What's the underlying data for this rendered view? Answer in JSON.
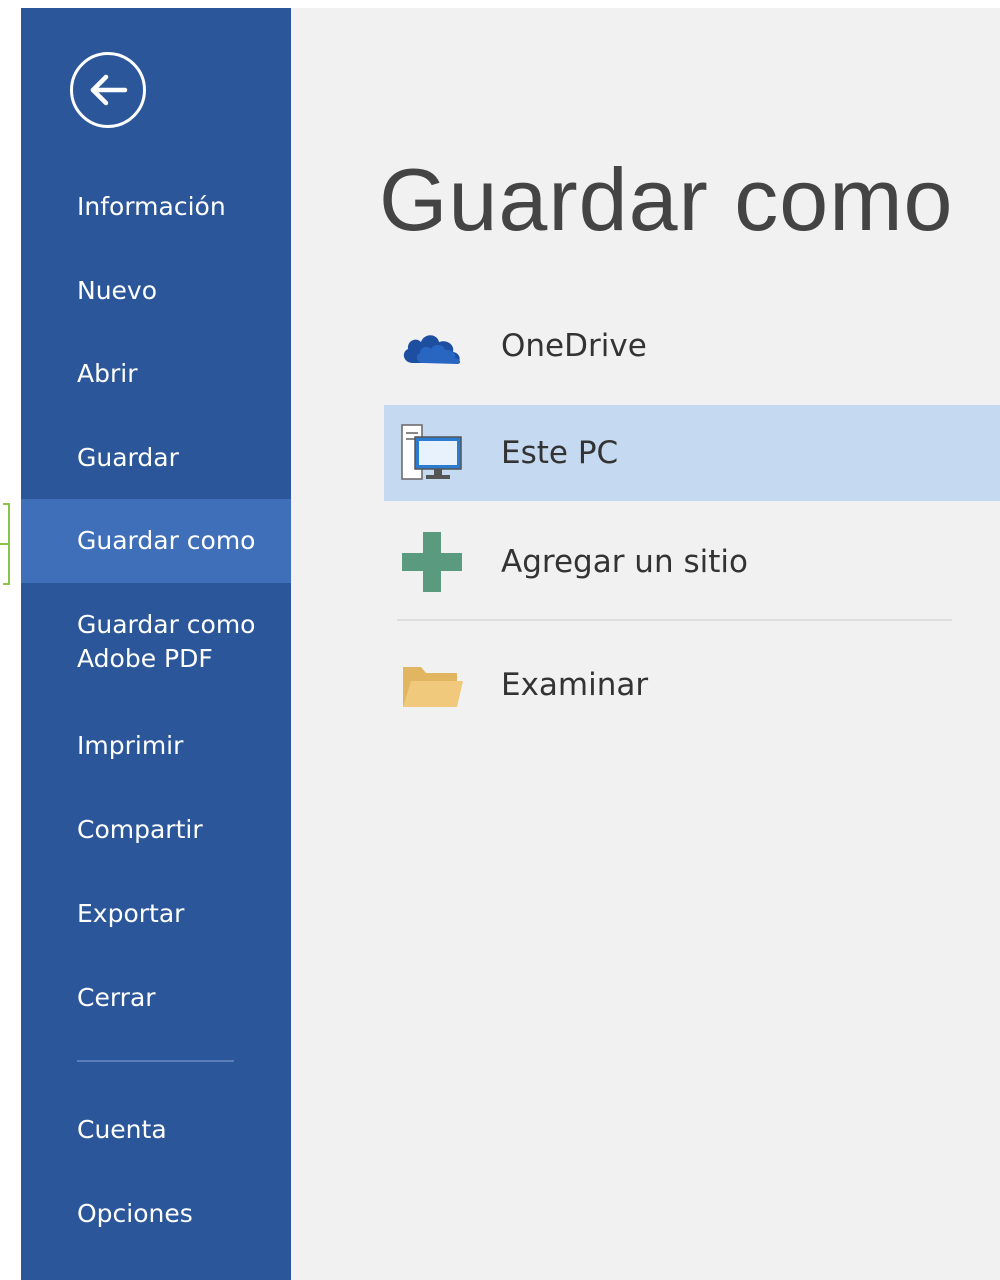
{
  "colors": {
    "sidebar_bg": "#2b579a",
    "sidebar_active": "#3f6fb9",
    "content_bg": "#f1f1f1",
    "selected_bg": "#c5d9f1",
    "onedrive_blue": "#1e4ea0",
    "add_green": "#5a9a7e",
    "folder": "#f0c97c"
  },
  "back_button": {
    "icon": "arrow-left-icon"
  },
  "sidebar": {
    "items": [
      {
        "label": "Información"
      },
      {
        "label": "Nuevo"
      },
      {
        "label": "Abrir"
      },
      {
        "label": "Guardar"
      },
      {
        "label": "Guardar como",
        "active": true
      },
      {
        "label_line1": "Guardar como",
        "label_line2": "Adobe PDF"
      },
      {
        "label": "Imprimir"
      },
      {
        "label": "Compartir"
      },
      {
        "label": "Exportar"
      },
      {
        "label": "Cerrar"
      }
    ],
    "bottom_items": [
      {
        "label": "Cuenta"
      },
      {
        "label": "Opciones"
      }
    ]
  },
  "main": {
    "title": "Guardar como",
    "places": [
      {
        "label": "OneDrive",
        "icon": "cloud-icon"
      },
      {
        "label": "Este PC",
        "icon": "computer-icon",
        "selected": true
      },
      {
        "label": "Agregar un sitio",
        "icon": "plus-icon"
      },
      {
        "label": "Examinar",
        "icon": "folder-icon"
      }
    ]
  }
}
